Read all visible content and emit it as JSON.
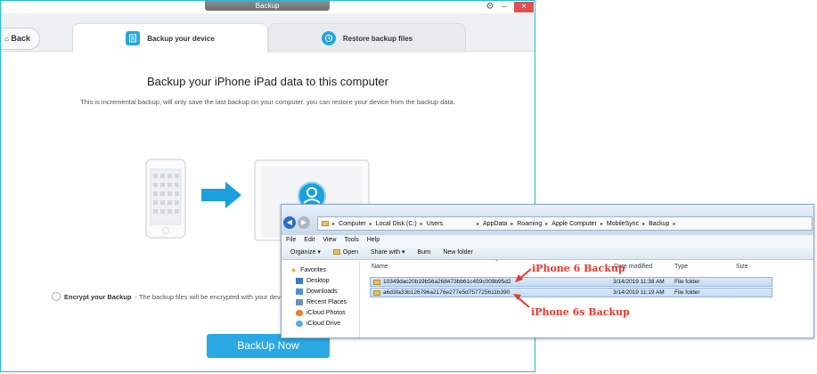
{
  "window": {
    "title": "Backup",
    "controls": {
      "settings_icon": "gear-icon",
      "minimize": "–",
      "close": "×"
    }
  },
  "nav": {
    "back_label": "Back"
  },
  "tabs": [
    {
      "label": "Backup your device",
      "icon": "document-icon",
      "active": true
    },
    {
      "label": "Restore backup files",
      "icon": "restore-clock-icon",
      "active": false
    }
  ],
  "main": {
    "title": "Backup your iPhone iPad data to this computer",
    "subtitle": "This is incremental backup, will only save the last backup on your computer. you can restore your device from the backup data.",
    "encrypt_label": "Encrypt your Backup",
    "encrypt_desc": " - The backup files will be encrypted with your device bac",
    "backup_button": "BackUp Now"
  },
  "explorer": {
    "breadcrumbs": [
      "Computer",
      "Local Disk (C:)",
      "Users",
      "AppData",
      "Roaming",
      "Apple Computer",
      "MobileSync",
      "Backup"
    ],
    "menu": [
      "File",
      "Edit",
      "View",
      "Tools",
      "Help"
    ],
    "toolbar": [
      "Organize ▾",
      "Open",
      "Share with ▾",
      "Burn",
      "New folder"
    ],
    "sidebar": {
      "favorites_label": "Favorites",
      "items": [
        "Desktop",
        "Downloads",
        "Recent Places",
        "iCloud Photos",
        "iCloud Drive"
      ]
    },
    "columns": {
      "name": "Name",
      "date": "Date modified",
      "type": "Type",
      "size": "Size"
    },
    "rows": [
      {
        "name": "10349dac20b19b56a268473bb61c459c009b95d2",
        "date": "3/14/2019 11:38 AM",
        "type": "File folder"
      },
      {
        "name": "a6d3fa33b126796a2176e277e5d757725611b390",
        "date": "3/14/2019 11:19 AM",
        "type": "File folder"
      }
    ]
  },
  "annotations": {
    "first": "iPhone 6 Backup",
    "second": "iPhone 6s Backup",
    "color": "#e03a2f"
  },
  "colors": {
    "accent": "#2aa8e3",
    "window_border": "#26b8d8"
  }
}
